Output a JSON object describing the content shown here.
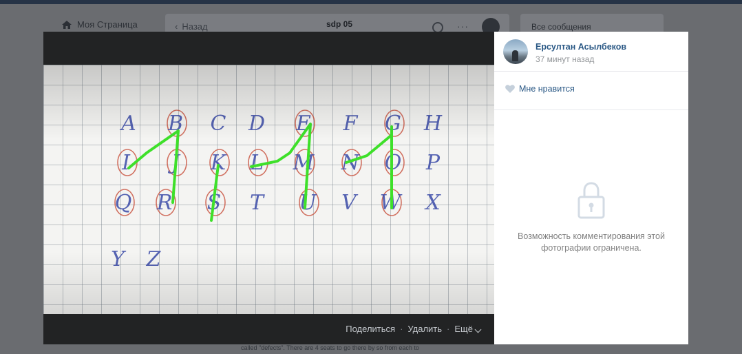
{
  "background": {
    "nav_my_page": "Моя Страница",
    "back_label": "Назад",
    "chat_title": "sdp 05",
    "all_messages": "Все сообщения",
    "bottom_text": "called \"defects\". There are 4 seats to go there by so from each to"
  },
  "photo": {
    "handwritten_letters": {
      "row1": [
        "A",
        "B",
        "C",
        "D",
        "E",
        "F",
        "G",
        "H"
      ],
      "row2": [
        "I",
        "J",
        "K",
        "L",
        "M",
        "N",
        "O",
        "P"
      ],
      "row3": [
        "Q",
        "R",
        "S",
        "T",
        "U",
        "V",
        "W",
        "X"
      ],
      "row4": [
        "Y",
        "Z"
      ]
    },
    "stroke_color": "#3ee02a",
    "circle_color": "#c8503c",
    "ink_color": "#3a4aa8"
  },
  "actions": {
    "share": "Поделиться",
    "delete": "Удалить",
    "more": "Ещё",
    "separator": "·"
  },
  "author": {
    "name": "Ерсултан Асылбеков",
    "time": "37 минут назад"
  },
  "like_label": "Мне нравится",
  "comments_restricted": "Возможность комментирования этой фотографии ограничена.",
  "colors": {
    "link": "#2a5885",
    "muted": "#939699",
    "viewer_dark": "#222324"
  }
}
